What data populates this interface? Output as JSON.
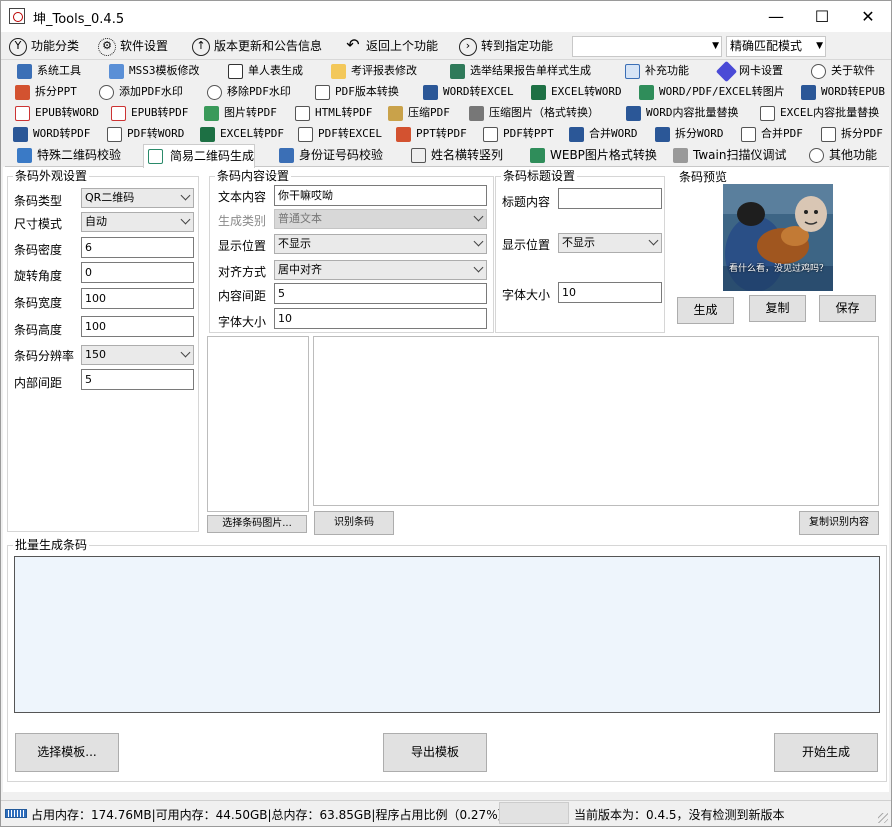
{
  "window": {
    "title": "坤_Tools_0.4.5",
    "minimize": "—",
    "maximize": "☐",
    "close": "✕"
  },
  "menu": {
    "items": [
      "功能分类",
      "软件设置",
      "版本更新和公告信息",
      "返回上个功能",
      "转到指定功能"
    ],
    "search_value": "",
    "match_mode": "精确匹配模式"
  },
  "tabs": {
    "row1": [
      "系统工具",
      "MSS3模板修改",
      "单人表生成",
      "考评报表修改",
      "选举结果报告单样式生成",
      "补充功能",
      "网卡设置",
      "关于软件"
    ],
    "row2": [
      "拆分PPT",
      "添加PDF水印",
      "移除PDF水印",
      "PDF版本转换",
      "WORD转EXCEL",
      "EXCEL转WORD",
      "WORD/PDF/EXCEL转图片",
      "WORD转EPUB"
    ],
    "row3": [
      "EPUB转WORD",
      "EPUB转PDF",
      "图片转PDF",
      "HTML转PDF",
      "压缩PDF",
      "压缩图片（格式转换）",
      "WORD内容批量替换",
      "EXCEL内容批量替换"
    ],
    "row4": [
      "WORD转PDF",
      "PDF转WORD",
      "EXCEL转PDF",
      "PDF转EXCEL",
      "PPT转PDF",
      "PDF转PPT",
      "合并WORD",
      "拆分WORD",
      "合并PDF",
      "拆分PDF"
    ],
    "row5": [
      "特殊二维码校验",
      "简易二维码生成",
      "身份证号码校验",
      "姓名横转竖列",
      "WEBP图片格式转换",
      "Twain扫描仪调试",
      "其他功能"
    ]
  },
  "appearance": {
    "title": "条码外观设置",
    "type_label": "条码类型",
    "type_value": "QR二维码",
    "size_label": "尺寸模式",
    "size_value": "自动",
    "density_label": "条码密度",
    "density_value": "6",
    "rotation_label": "旋转角度",
    "rotation_value": "0",
    "width_label": "条码宽度",
    "width_value": "100",
    "height_label": "条码高度",
    "height_value": "100",
    "resolution_label": "条码分辨率",
    "resolution_value": "150",
    "padding_label": "内部间距",
    "padding_value": "5"
  },
  "content_settings": {
    "title": "条码内容设置",
    "text_label": "文本内容",
    "text_value": "你干嘛哎呦",
    "gen_type_label": "生成类别",
    "gen_type_value": "普通文本",
    "position_label": "显示位置",
    "position_value": "不显示",
    "align_label": "对齐方式",
    "align_value": "居中对齐",
    "spacing_label": "内容间距",
    "spacing_value": "5",
    "font_label": "字体大小",
    "font_value": "10"
  },
  "title_settings": {
    "title": "条码标题设置",
    "content_label": "标题内容",
    "content_value": "",
    "position_label": "显示位置",
    "position_value": "不显示",
    "font_label": "字体大小",
    "font_value": "10"
  },
  "preview": {
    "title": "条码预览",
    "caption": "看什么看，没见过鸡吗？",
    "generate": "生成",
    "copy": "复制",
    "save": "保存"
  },
  "recognize": {
    "select_image": "选择条码图片...",
    "recognize": "识别条码",
    "copy_result": "复制识别内容"
  },
  "batch": {
    "title": "批量生成条码",
    "select_template": "选择模板...",
    "export_template": "导出模板",
    "start": "开始生成"
  },
  "status": {
    "memory": "占用内存：174.76MB|可用内存：44.50GB|总内存：63.85GB|程序占用比例（0.27%）",
    "version": "当前版本为：0.4.5，没有检测到新版本"
  }
}
